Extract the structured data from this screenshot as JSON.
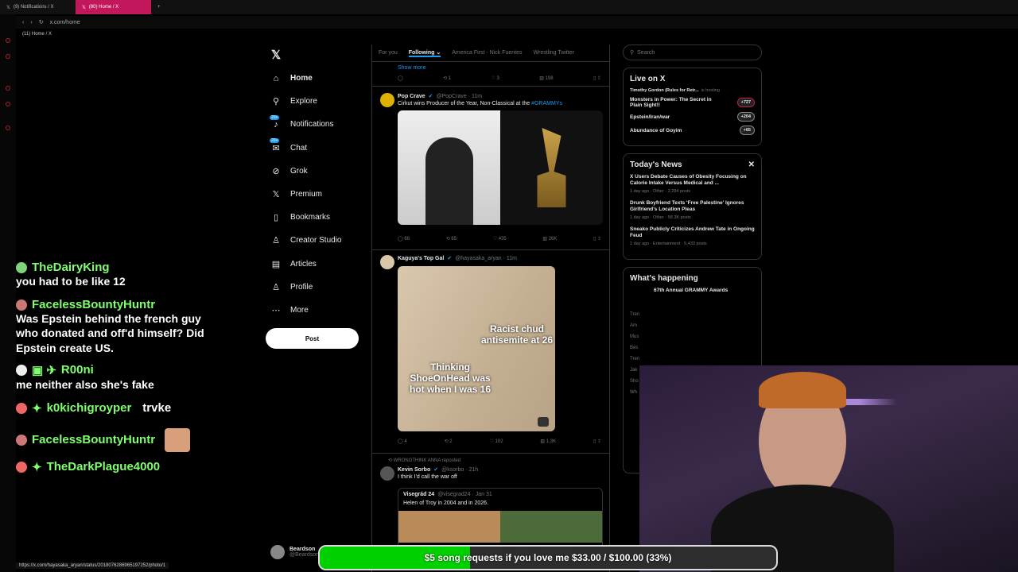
{
  "browser": {
    "tabs": [
      {
        "label": "(9) Notifications / X"
      },
      {
        "label": "(80) Home / X"
      }
    ],
    "url": "x.com/home",
    "page_tab": "(11) Home / X",
    "status_url": "https://x.com/hayasaka_aryan/status/2018076286965197252/photo/1"
  },
  "nav": {
    "items": [
      "Home",
      "Explore",
      "Notifications",
      "Chat",
      "Grok",
      "Premium",
      "Bookmarks",
      "Creator Studio",
      "Articles",
      "Profile",
      "More"
    ],
    "badge": "20+",
    "post": "Post"
  },
  "feed": {
    "tabs": [
      "For you",
      "Following",
      "America First - Nick Fuentes",
      "Wrestling Twitter"
    ],
    "show_more": "Show more",
    "top_actions": {
      "reposts": "1",
      "likes": "3",
      "views": "198"
    },
    "tweet1": {
      "name": "Pop Crave",
      "handle": "@PopCrave · 11m",
      "text": "Cirkut wins Producer of the Year, Non-Classical at the ",
      "hashtag": "#GRAMMYs",
      "replies": "66",
      "reposts": "65",
      "likes": "435",
      "views": "26K"
    },
    "tweet2": {
      "name": "Kaguya's Top Gal",
      "handle": "@hayasaka_aryan · 11m",
      "meme_top": "Racist chud antisemite at 26",
      "meme_bottom": "Thinking ShoeOnHead was hot when I was 16",
      "replies": "4",
      "reposts": "2",
      "likes": "102",
      "views": "1.3K"
    },
    "tweet3": {
      "repost": "WRONGTHINK ANNA reposted",
      "name": "Kevin Sorbo",
      "handle": "@ksorbo · 21h",
      "text": "I think I'd call the war off",
      "quote_name": "Visegrád 24",
      "quote_handle": "@visegrad24 · Jan 31",
      "quote_text": "Helen of Troy in 2004 and in 2026."
    },
    "account": {
      "name": "Beardson",
      "handle": "@Beardson"
    }
  },
  "right": {
    "search": "Search",
    "live_title": "Live on X",
    "host": "Timothy Gordon (Rules for Retr...",
    "host_suffix": "is hosting",
    "spaces": [
      {
        "title": "Monsters in Power: The Secret in Plain Sight!!",
        "count": "+727"
      },
      {
        "title": "Epstein/Iran/war",
        "count": "+204"
      },
      {
        "title": "Abundance of Goyim",
        "count": "+65"
      }
    ],
    "news_title": "Today's News",
    "news": [
      {
        "title": "X Users Debate Causes of Obesity Focusing on Calorie Intake Versus Medical and ...",
        "meta": "1 day ago · Other · 2,294 posts"
      },
      {
        "title": "Drunk Boyfriend Texts 'Free Palestine' Ignores Girlfriend's Location Pleas",
        "meta": "1 day ago · Other · 58.3K posts"
      },
      {
        "title": "Sneako Publicly Criticizes Andrew Tate in Ongoing Feud",
        "meta": "1 day ago · Entertainment · 5,433 posts"
      }
    ],
    "happening_title": "What's happening",
    "happening_item": "67th Annual GRAMMY Awards",
    "partial": [
      "Tren",
      "Am",
      "Mus",
      "Bes",
      "Tren",
      "Jak",
      "Sho",
      "Wh"
    ]
  },
  "chat": [
    {
      "name": "TheDairyKing",
      "msg": "you had to be like 12",
      "color": "#7fff6e"
    },
    {
      "name": "FacelessBountyHuntr",
      "msg": "Was Epstein behind the french guy who donated and off'd himself? Did Epstein create US.",
      "color": "#7fff6e"
    },
    {
      "name": "R00ni",
      "msg": "me neither also she's fake",
      "color": "#7fff6e"
    },
    {
      "name": "k0kichigroyper",
      "msg": "trvke",
      "color": "#7fff6e"
    },
    {
      "name": "FacelessBountyHuntr",
      "msg": "",
      "color": "#7fff6e"
    },
    {
      "name": "TheDarkPlague4000",
      "msg": "",
      "color": "#7fff6e"
    }
  ],
  "goal": {
    "text": "$5 song requests if you love me $33.00 / $100.00 (33%)",
    "progress": 0.33
  }
}
